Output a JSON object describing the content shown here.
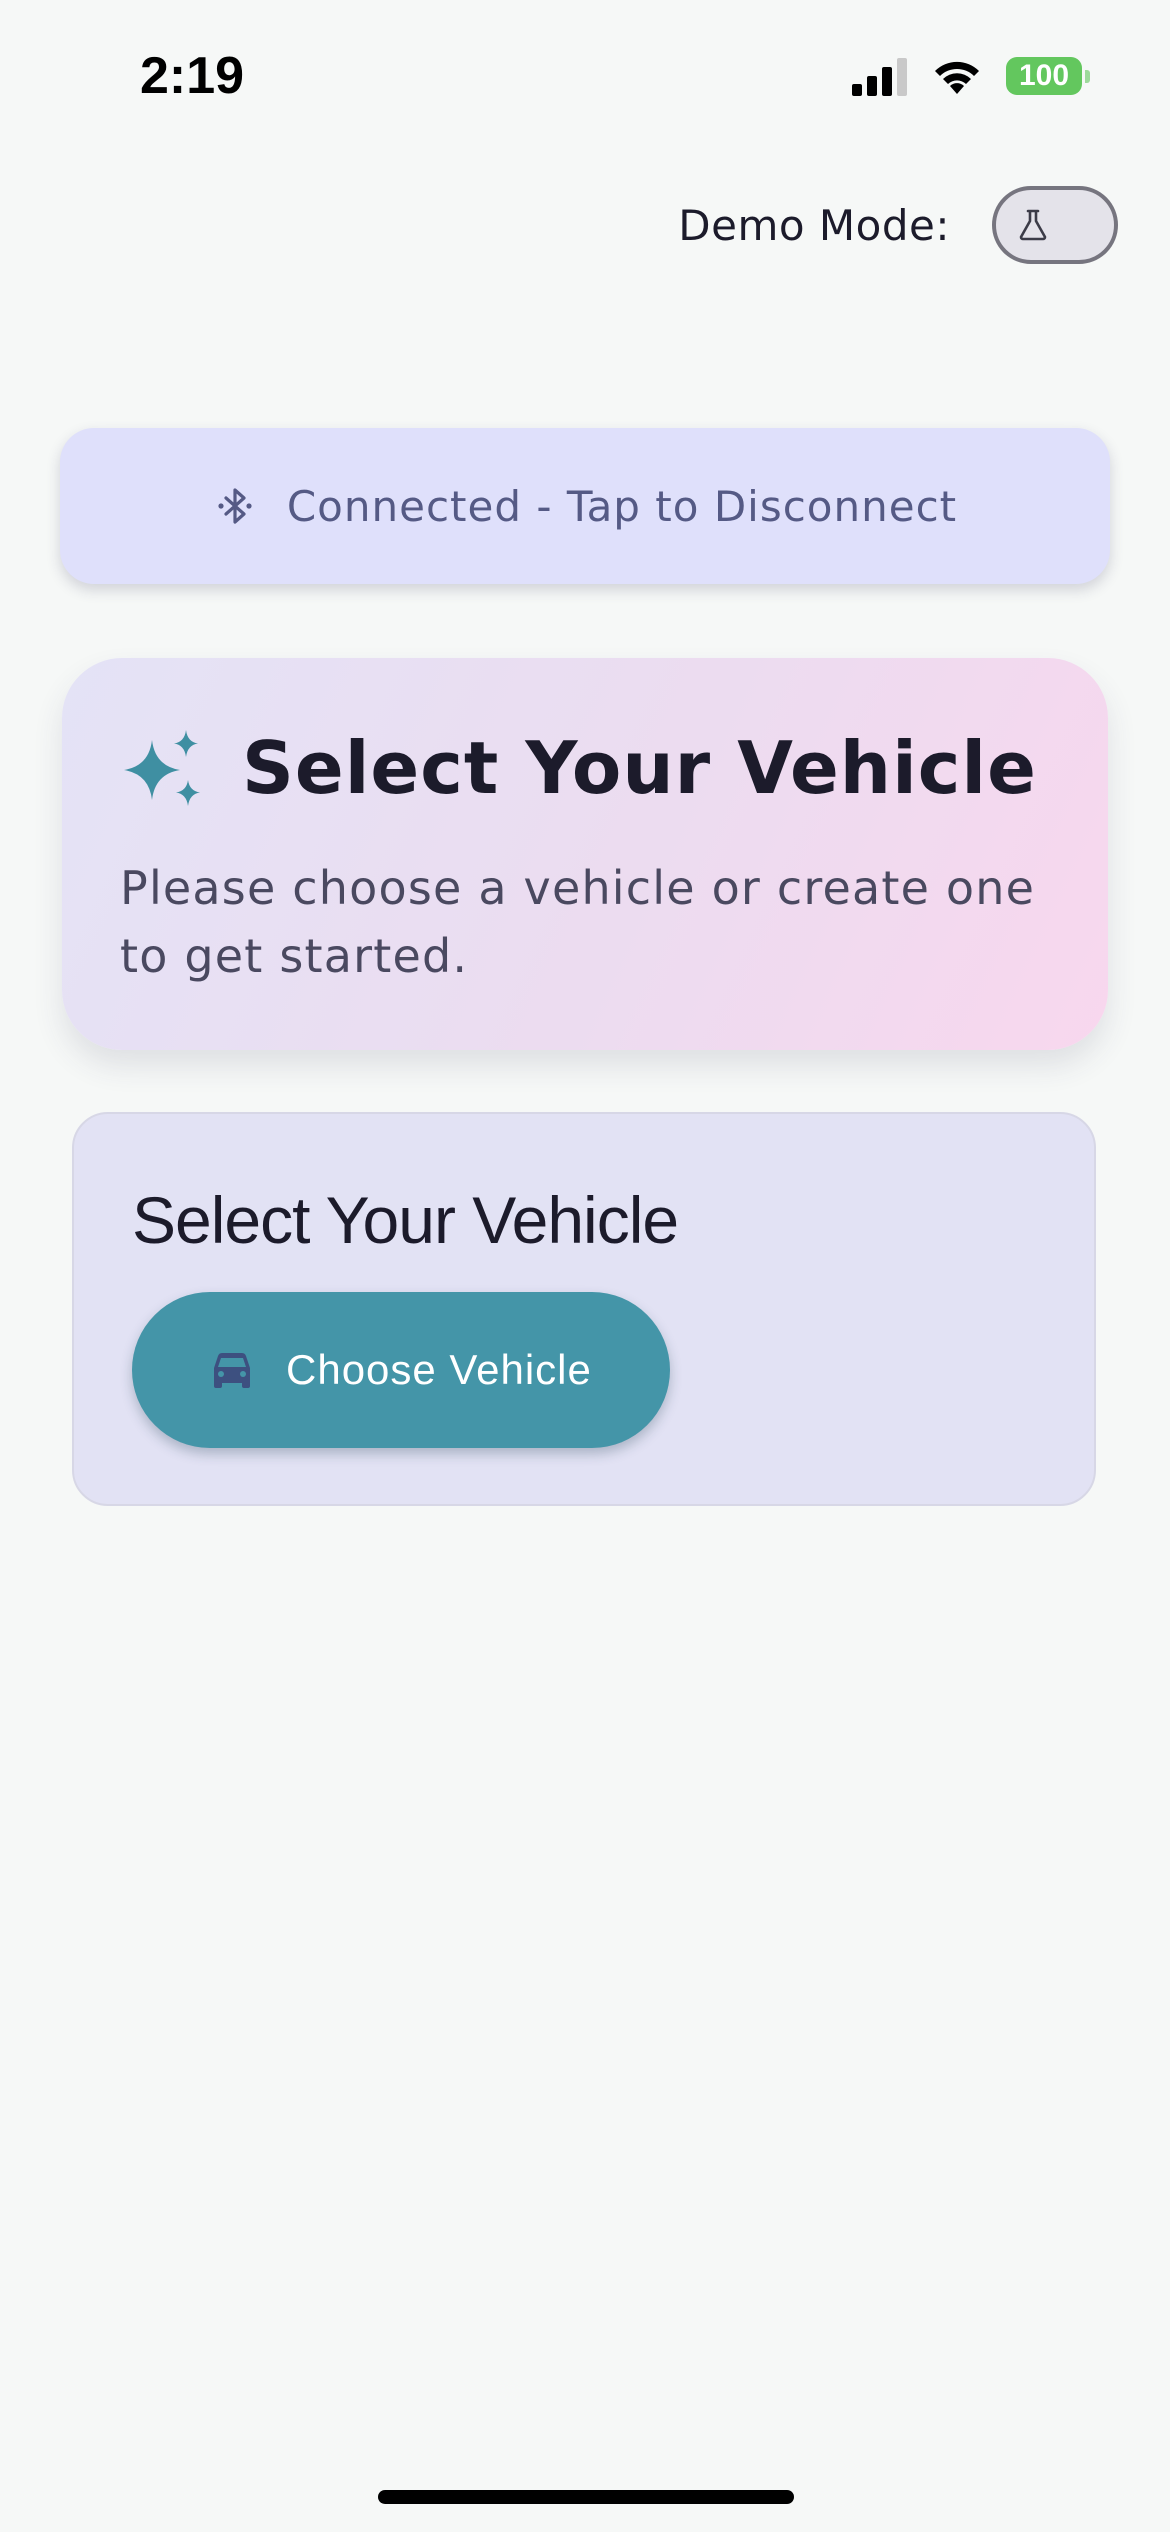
{
  "status_bar": {
    "time": "2:19",
    "battery_level": "100",
    "icons": [
      "signal-icon",
      "wifi-icon",
      "battery-icon"
    ]
  },
  "demo_mode": {
    "label": "Demo Mode:",
    "toggle_on": false,
    "icon": "flask-icon"
  },
  "connection": {
    "label": "Connected - Tap to Disconnect",
    "icon": "bluetooth-icon"
  },
  "hero": {
    "title": "Select Your Vehicle",
    "subtitle": "Please choose a vehicle or create one to get started.",
    "icon": "sparkle-icon"
  },
  "vehicle_selector": {
    "title": "Select Your Vehicle",
    "button_label": "Choose Vehicle",
    "button_icon": "car-icon"
  },
  "colors": {
    "accent": "#4495a8",
    "banner_bg": "#dfe0fb",
    "battery": "#63c75e"
  }
}
